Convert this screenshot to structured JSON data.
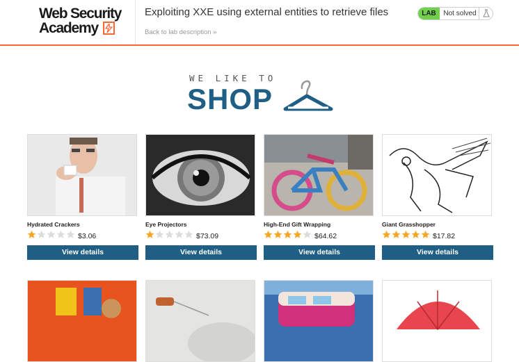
{
  "header": {
    "logo_line1": "Web Security",
    "logo_line2": "Academy",
    "lab_title": "Exploiting XXE using external entities to retrieve files",
    "back_link": "Back to lab description",
    "badge_tag": "LAB",
    "badge_status": "Not solved"
  },
  "hero": {
    "small_text": "WE LIKE TO",
    "big_text": "SHOP"
  },
  "products": [
    {
      "name": "Hydrated Crackers",
      "price": "$3.06",
      "rating": 1,
      "button": "View details",
      "image": "man-eating-cracker-photo"
    },
    {
      "name": "Eye Projectors",
      "price": "$73.09",
      "rating": 1,
      "button": "View details",
      "image": "eye-closeup-photo"
    },
    {
      "name": "High-End Gift Wrapping",
      "price": "$64.62",
      "rating": 4,
      "button": "View details",
      "image": "yarn-wrapped-bicycle-photo"
    },
    {
      "name": "Giant Grasshopper",
      "price": "$17.82",
      "rating": 5,
      "button": "View details",
      "image": "grasshopper-sketch"
    },
    {
      "name": "",
      "price": "",
      "rating": 0,
      "button": "",
      "image": "toy-figure-photo"
    },
    {
      "name": "",
      "price": "",
      "rating": 0,
      "button": "",
      "image": "tea-bag-photo"
    },
    {
      "name": "",
      "price": "",
      "rating": 0,
      "button": "",
      "image": "camper-van-photo"
    },
    {
      "name": "",
      "price": "",
      "rating": 0,
      "button": "",
      "image": "red-umbrella-photo"
    }
  ],
  "colors": {
    "accent_orange": "#ff6633",
    "brand_blue": "#1f5f86",
    "star_gold": "#f5a623",
    "star_empty": "#dcdcdc",
    "lab_green": "#70d04b"
  }
}
